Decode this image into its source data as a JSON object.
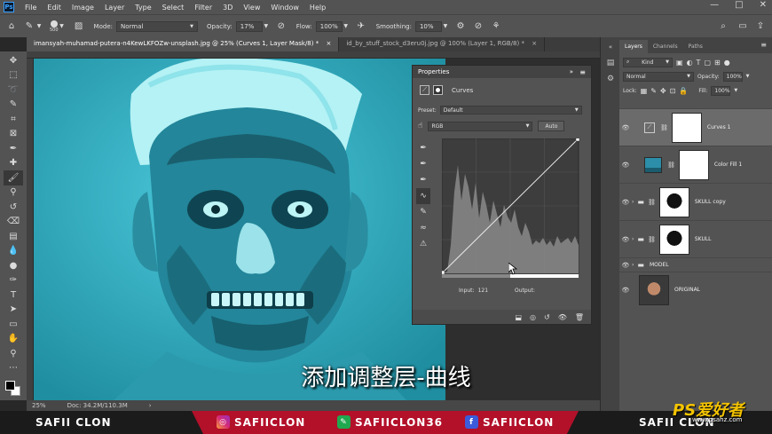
{
  "app": {
    "logo": "Ps"
  },
  "menu": [
    "File",
    "Edit",
    "Image",
    "Layer",
    "Type",
    "Select",
    "Filter",
    "3D",
    "View",
    "Window",
    "Help"
  ],
  "window_controls": {
    "minimize": "—",
    "maximize": "□",
    "close": "✕"
  },
  "options": {
    "brush_size": "500",
    "mode_label": "Mode:",
    "mode_value": "Normal",
    "opacity_label": "Opacity:",
    "opacity_value": "17%",
    "flow_label": "Flow:",
    "flow_value": "100%",
    "smoothing_label": "Smoothing:",
    "smoothing_value": "10%"
  },
  "doc_tabs": [
    {
      "label": "imansyah-muhamad-putera-n4KewLKFOZw-unsplash.jpg @ 25% (Curves 1, Layer Mask/8) *",
      "close": "×"
    },
    {
      "label": "id_by_stuff_stock_d3eru0j.jpg @ 100% (Layer 1, RGB/8) *",
      "close": "×"
    }
  ],
  "status": {
    "zoom": "25%",
    "doc": "Doc: 34.2M/110.3M",
    "arrow": "›"
  },
  "properties": {
    "title": "Properties",
    "panel_name": "Curves",
    "preset_label": "Preset:",
    "preset_value": "Default",
    "channel_value": "RGB",
    "auto_label": "Auto",
    "input_label": "Input:",
    "input_value": "121",
    "output_label": "Output:"
  },
  "layers_panel": {
    "tabs": [
      "Layers",
      "Channels",
      "Paths"
    ],
    "kind_label": "Kind",
    "blend_mode": "Normal",
    "opacity_label": "Opacity:",
    "opacity_value": "100%",
    "lock_label": "Lock:",
    "fill_label": "Fill:",
    "fill_value": "100%",
    "layers": [
      {
        "name": "Curves 1"
      },
      {
        "name": "Color Fill 1"
      },
      {
        "name": "SKULL copy"
      },
      {
        "name": "SKULL"
      },
      {
        "name": "MODEL"
      },
      {
        "name": "ORIGINAL"
      }
    ]
  },
  "subtitle": "添加调整层-曲线",
  "banner": {
    "left_name": "SAFII CLON",
    "instagram": "SAFIICLON",
    "other": "SAFIICLON36",
    "facebook": "SAFIICLON",
    "right_name": "SAFII CLON"
  },
  "watermark": {
    "brand": "PS爱好者",
    "url": "www.psahz.com"
  },
  "colors": {
    "canvas": "#3db6c9",
    "banner_red": "#b3102a",
    "panel": "#535353"
  }
}
